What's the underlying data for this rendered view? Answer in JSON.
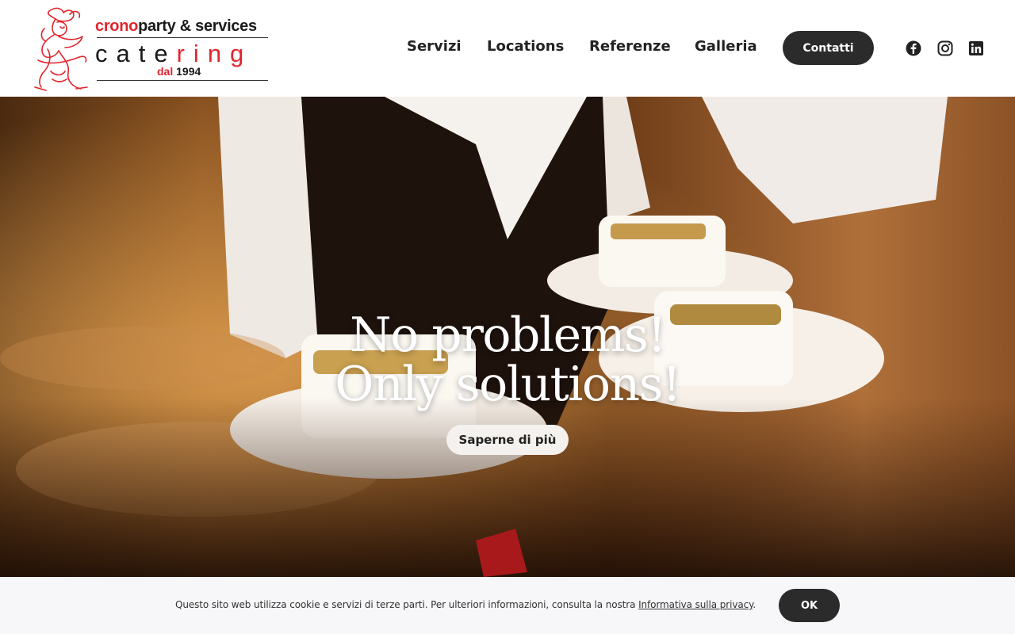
{
  "header": {
    "logo": {
      "line1_red": "crono",
      "line1_rest": "party & services",
      "cater_black": "cate",
      "cater_red": "ring",
      "dal_red": "dal",
      "dal_year": "1994"
    },
    "nav": [
      "Servizi",
      "Locations",
      "Referenze",
      "Galleria"
    ],
    "contact_label": "Contatti",
    "social": [
      "facebook-icon",
      "instagram-icon",
      "linkedin-icon"
    ]
  },
  "hero": {
    "title_line1": "No problems!",
    "title_line2": "Only solutions!",
    "button_label": "Saperne di più"
  },
  "cookie": {
    "text": "Questo sito web utilizza cookie e servizi di terze parti. Per ulteriori informazioni, consulta la nostra ",
    "link_text": "Informativa sulla privacy",
    "text_end": ".",
    "ok_label": "OK"
  },
  "colors": {
    "brand_red": "#e0262c",
    "dark_button": "#2b2b2b"
  }
}
